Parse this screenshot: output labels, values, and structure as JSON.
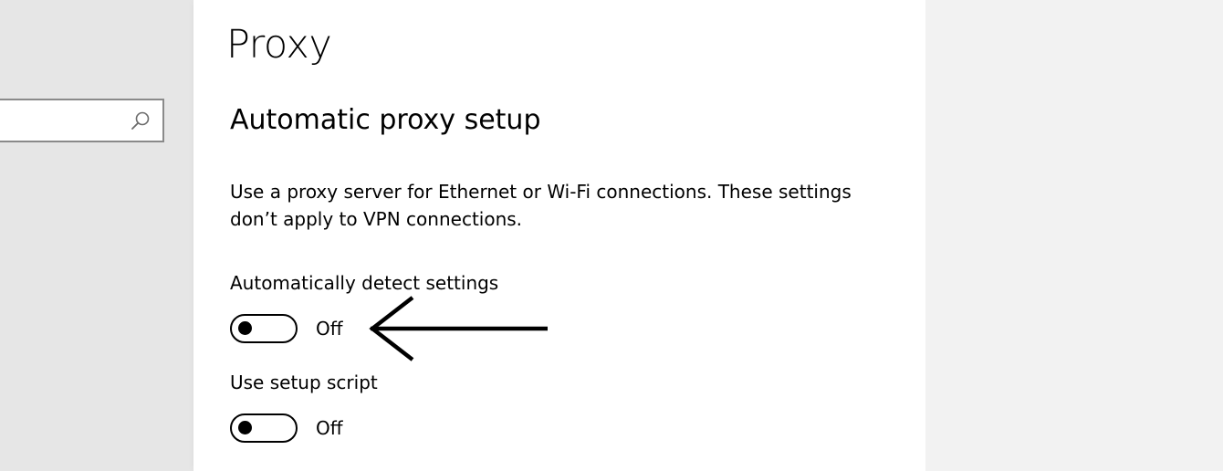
{
  "search": {
    "placeholder": "",
    "icon": "search-icon"
  },
  "page": {
    "title": "Proxy"
  },
  "automatic_proxy": {
    "section_title": "Automatic proxy setup",
    "description": "Use a proxy server for Ethernet or Wi-Fi connections. These settings don’t apply to VPN connections.",
    "settings": [
      {
        "label": "Automatically detect settings",
        "state": "Off",
        "on": false
      },
      {
        "label": "Use setup script",
        "state": "Off",
        "on": false
      }
    ]
  },
  "annotation": {
    "arrow_icon": "arrow-left-icon",
    "color": "#000000"
  },
  "colors": {
    "left_pane": "#e6e6e6",
    "main_pane": "#ffffff",
    "right_pane": "#f2f2f2",
    "search_border": "#8a8a8a"
  }
}
